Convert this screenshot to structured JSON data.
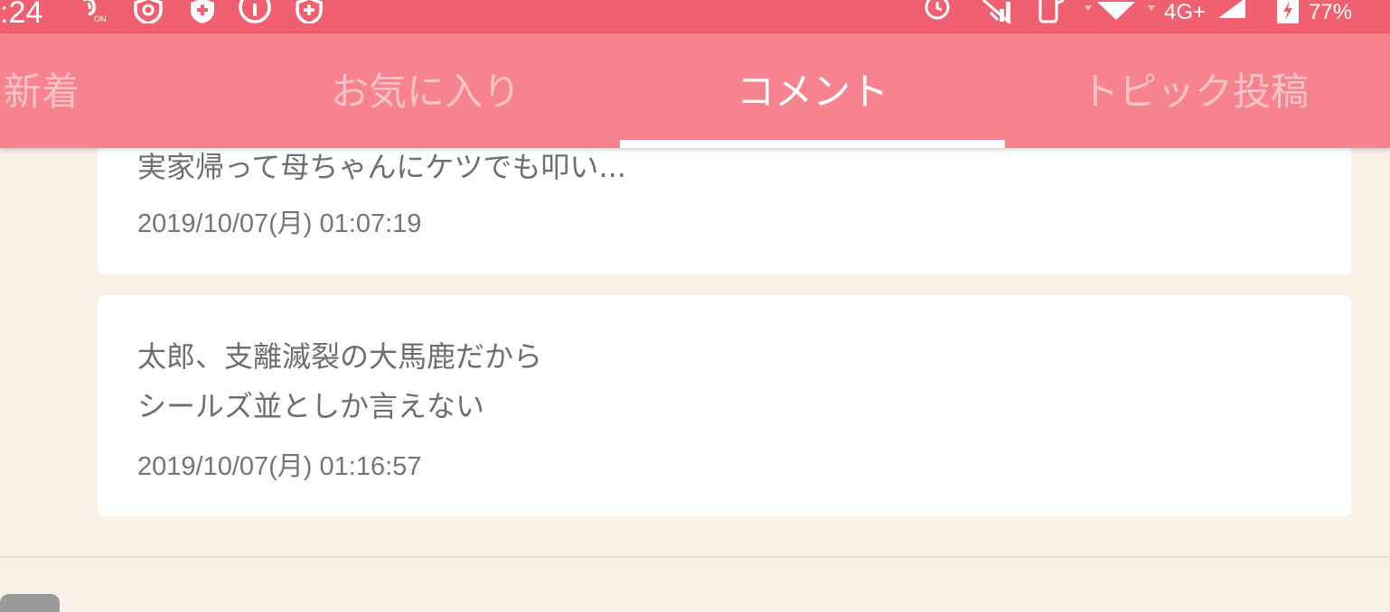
{
  "status_bar": {
    "time": ":24",
    "network": "4G+",
    "battery": "77%",
    "icons": [
      "nfc-on-icon",
      "shield-icon",
      "shield-plus-icon",
      "info-icon",
      "shield-plus-icon",
      "alarm-icon",
      "signal-icon",
      "phone-icon",
      "wifi-icon",
      "cell-signal-icon",
      "battery-charging-icon"
    ]
  },
  "tabs": [
    {
      "label": "新着"
    },
    {
      "label": "お気に入り"
    },
    {
      "label": "コメント",
      "active": true
    },
    {
      "label": "トピック投稿"
    }
  ],
  "comments": [
    {
      "text": "実家帰って母ちゃんにケツでも叩い...",
      "date": "2019/10/07(月) 01:07:19"
    },
    {
      "lines": [
        "太郎、支離滅裂の大馬鹿だから",
        "シールズ並としか言えない"
      ],
      "date": "2019/10/07(月) 01:16:57"
    }
  ],
  "colors": {
    "status_bar": "#f06070",
    "tab_bar": "#f6838d",
    "background": "#f9f0e6",
    "card": "#ffffff"
  }
}
